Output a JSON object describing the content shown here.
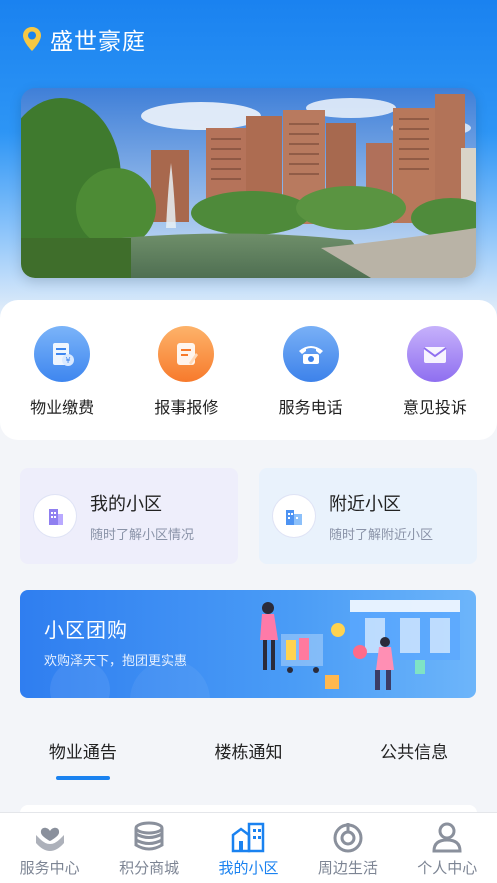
{
  "header": {
    "title": "盛世豪庭",
    "icon": "location-pin-icon"
  },
  "banner": {
    "description_icon": "residential-photo"
  },
  "quick_actions": [
    {
      "label": "物业缴费",
      "icon": "payment-icon",
      "color": "#5b9ff5"
    },
    {
      "label": "报事报修",
      "icon": "repair-icon",
      "color": "#fb8a3c"
    },
    {
      "label": "服务电话",
      "icon": "phone-icon",
      "color": "#4e93f2"
    },
    {
      "label": "意见投诉",
      "icon": "mail-icon",
      "color": "#a98cf3"
    }
  ],
  "cards": [
    {
      "title": "我的小区",
      "subtitle": "随时了解小区情况",
      "icon": "building-icon"
    },
    {
      "title": "附近小区",
      "subtitle": "随时了解附近小区",
      "icon": "buildings-icon"
    }
  ],
  "promo": {
    "title": "小区团购",
    "subtitle": "欢购泽天下，抱团更实惠"
  },
  "tabs": [
    {
      "label": "物业通告",
      "active": true
    },
    {
      "label": "楼栋通知",
      "active": false
    },
    {
      "label": "公共信息",
      "active": false
    }
  ],
  "tabbar": [
    {
      "label": "服务中心",
      "icon": "heart-hands-icon",
      "active": false
    },
    {
      "label": "积分商城",
      "icon": "coins-icon",
      "active": false
    },
    {
      "label": "我的小区",
      "icon": "community-icon",
      "active": true
    },
    {
      "label": "周边生活",
      "icon": "compass-icon",
      "active": false
    },
    {
      "label": "个人中心",
      "icon": "person-icon",
      "active": false
    }
  ],
  "colors": {
    "primary": "#1a82f0",
    "inactive": "#7d8594"
  }
}
